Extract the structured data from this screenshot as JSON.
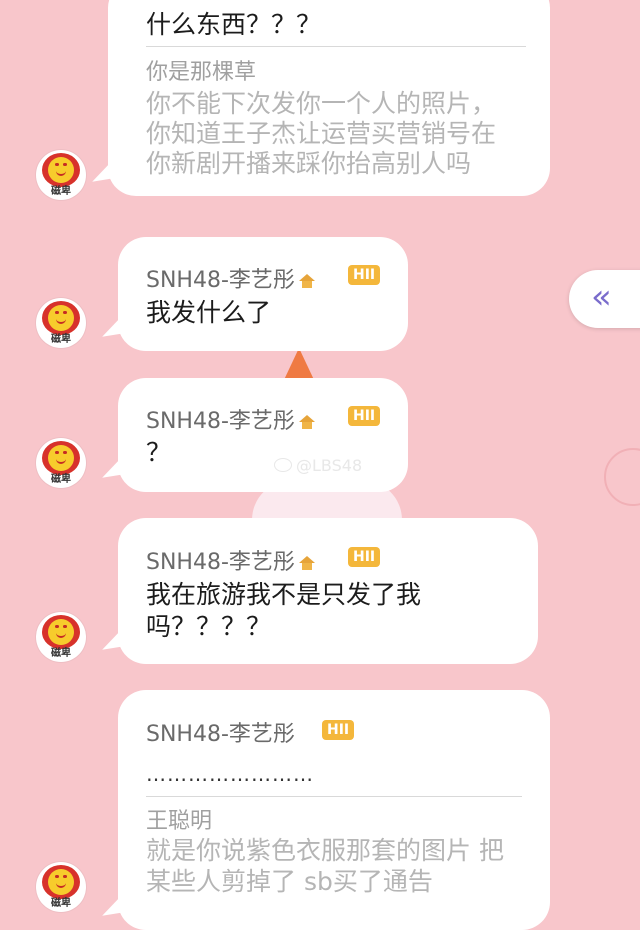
{
  "side_button": {
    "label": "«"
  },
  "watermark": {
    "text": "@LBS48"
  },
  "messages": [
    {
      "avatar_label": "磁卑",
      "line1": "什么东西？？？",
      "quote_author": "你是那棵草",
      "quote_lines": [
        "你不能下次发你一个人的照片，",
        "你知道王子杰让运营买营销号在",
        "你新剧开播来踩你抬高别人吗"
      ]
    },
    {
      "avatar_label": "磁卑",
      "sender": "SNH48-李艺彤",
      "badge": "HII",
      "text": "我发什么了"
    },
    {
      "avatar_label": "磁卑",
      "sender": "SNH48-李艺彤",
      "badge": "HII",
      "text": "？"
    },
    {
      "avatar_label": "磁卑",
      "sender": "SNH48-李艺彤",
      "badge": "HII",
      "text_lines": [
        "我在旅游我不是只发了我",
        "吗？？？？"
      ]
    },
    {
      "avatar_label": "磁卑",
      "sender": "SNH48-李艺彤",
      "badge": "HII",
      "text": "……………………",
      "quote_author": "王聪明",
      "quote_lines": [
        "就是你说紫色衣服那套的图片 把",
        "某些人剪掉了 sb买了通告"
      ]
    }
  ]
}
